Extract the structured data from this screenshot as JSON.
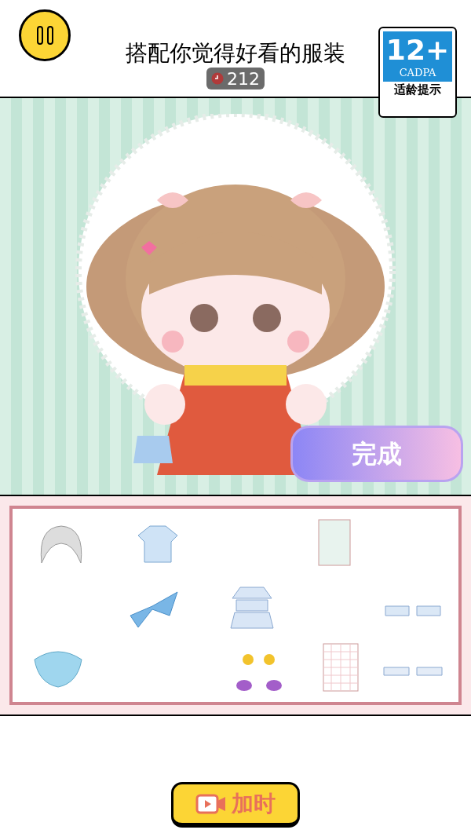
{
  "header": {
    "title": "搭配你觉得好看的服装",
    "timer": "212"
  },
  "age_badge": {
    "rating": "12+",
    "org": "CADPA",
    "label": "适龄提示"
  },
  "done_button": "完成",
  "add_time_button": "加时"
}
